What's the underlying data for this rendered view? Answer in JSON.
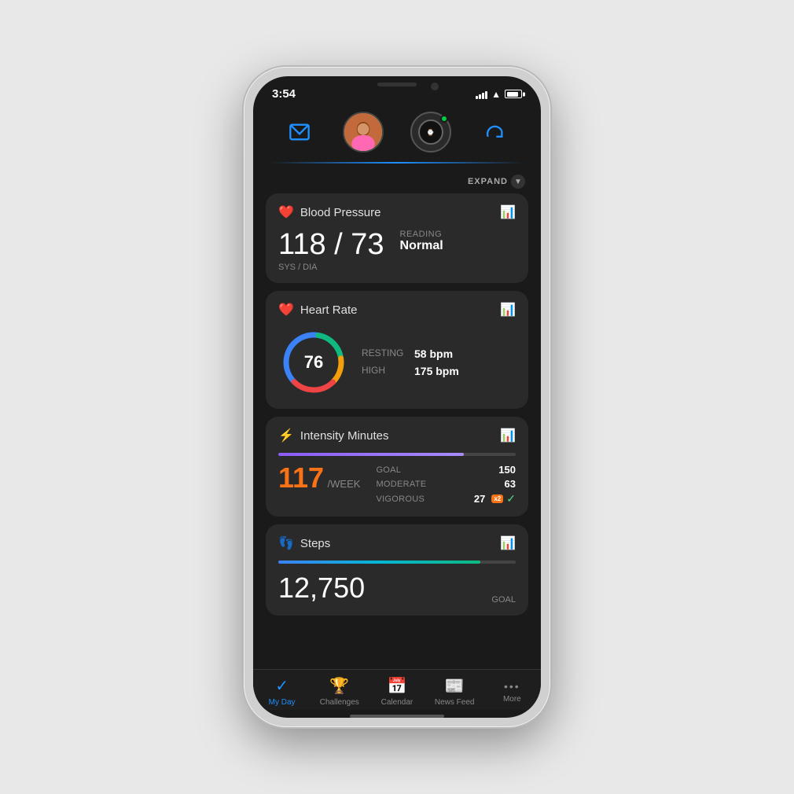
{
  "status_bar": {
    "time": "3:54",
    "signal": [
      3,
      5,
      7,
      9,
      11
    ],
    "wifi": "wifi",
    "battery": 85
  },
  "top_nav": {
    "inbox_icon": "inbox",
    "avatar_emoji": "👩🏾",
    "watch_icon": "⌚",
    "sync_icon": "🔄",
    "active_dot_color": "#00cc44"
  },
  "expand_bar": {
    "label": "EXPAND",
    "chevron": "▼"
  },
  "blood_pressure": {
    "title": "Blood Pressure",
    "value": "118 / 73",
    "unit": "SYS / DIA",
    "reading_label": "READING",
    "reading_value": "Normal"
  },
  "heart_rate": {
    "title": "Heart Rate",
    "current": "76",
    "resting_label": "RESTING",
    "resting_value": "58 bpm",
    "high_label": "HIGH",
    "high_value": "175 bpm"
  },
  "intensity_minutes": {
    "title": "Intensity Minutes",
    "value": "117",
    "unit": "/WEEK",
    "bar_percent": 78,
    "goal_label": "GOAL",
    "goal_value": "150",
    "moderate_label": "MODERATE",
    "moderate_value": "63",
    "vigorous_label": "VIGOROUS",
    "vigorous_value": "27",
    "x2_badge": "x2"
  },
  "steps": {
    "title": "Steps",
    "value": "12,750",
    "goal_label": "GOAL",
    "bar_percent": 85
  },
  "bottom_nav": {
    "items": [
      {
        "label": "My Day",
        "icon": "✓",
        "active": true
      },
      {
        "label": "Challenges",
        "icon": "🏆",
        "active": false
      },
      {
        "label": "Calendar",
        "icon": "📅",
        "active": false
      },
      {
        "label": "News Feed",
        "icon": "📰",
        "active": false
      },
      {
        "label": "More",
        "icon": "•••",
        "active": false
      }
    ]
  }
}
